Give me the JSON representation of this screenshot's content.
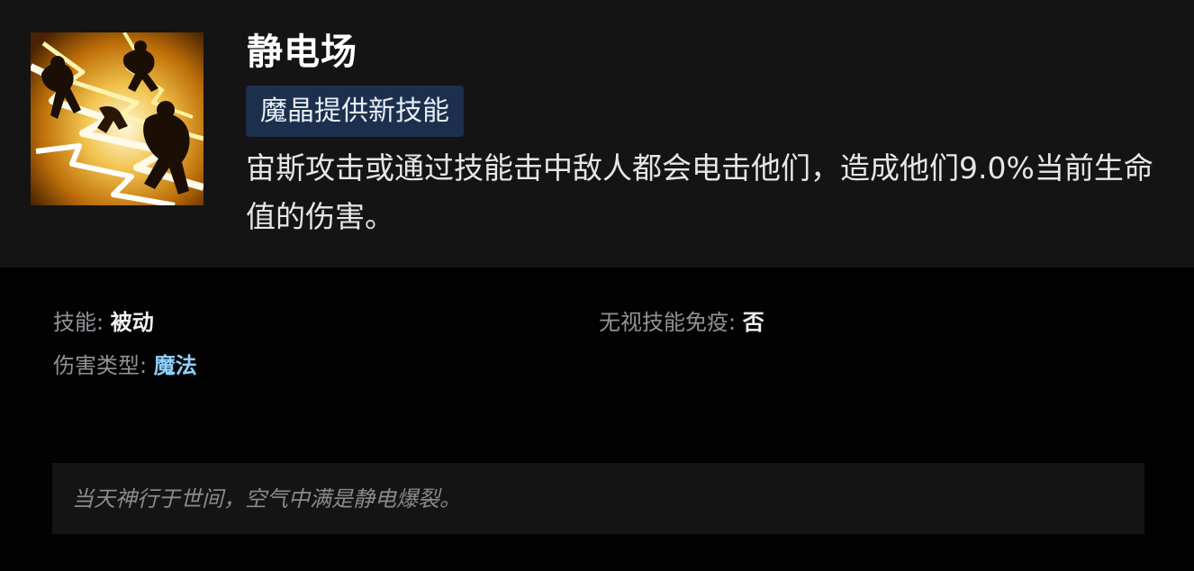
{
  "ability": {
    "name": "静电场",
    "badge": "魔晶提供新技能",
    "description": "宙斯攻击或通过技能击中敌人都会电击他们，造成他们9.0%当前生命值的伤害。",
    "icon": "zeus-static-field-icon"
  },
  "stats": {
    "skill_label": "技能: ",
    "skill_value": "被动",
    "damage_type_label": "伤害类型: ",
    "damage_type_value": "魔法",
    "spell_immunity_label": "无视技能免疫: ",
    "spell_immunity_value": "否"
  },
  "lore": {
    "text": "当天神行于世间，空气中满是静电爆裂。"
  },
  "colors": {
    "page_background": "#020202",
    "header_background": "#141415",
    "badge_background": "#1c304e",
    "magic_damage": "#8fd0ff",
    "label_gray": "#8f9296"
  }
}
